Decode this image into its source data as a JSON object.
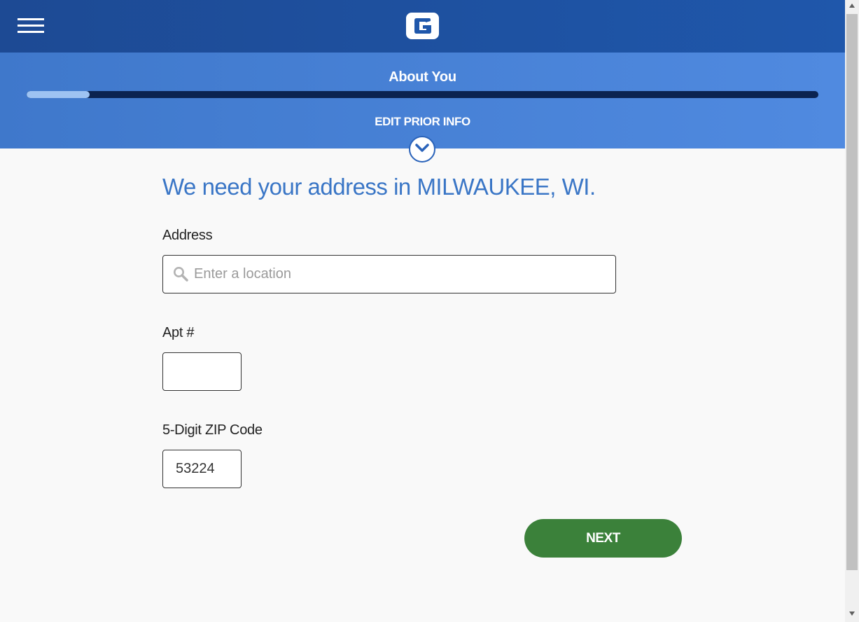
{
  "header": {
    "menu_icon": "hamburger-menu-icon",
    "logo_icon": "geico-g-logo-icon"
  },
  "progress": {
    "step_title": "About You",
    "percent": 8,
    "edit_prior_label": "EDIT PRIOR INFO",
    "expand_icon": "chevron-down-circle-icon"
  },
  "form": {
    "title": "We need your address in MILWAUKEE, WI.",
    "address": {
      "label": "Address",
      "placeholder": "Enter a location",
      "value": "",
      "icon": "search-icon"
    },
    "apt": {
      "label": "Apt #",
      "value": ""
    },
    "zip": {
      "label": "5-Digit ZIP Code",
      "value": "53224"
    },
    "next_label": "NEXT"
  },
  "colors": {
    "navbar": "#1f57ab",
    "header": "#508ae0",
    "title": "#3a76c6",
    "next_button": "#3b813a",
    "progress_track": "#0b2350",
    "progress_fill": "#9ec3f2"
  }
}
